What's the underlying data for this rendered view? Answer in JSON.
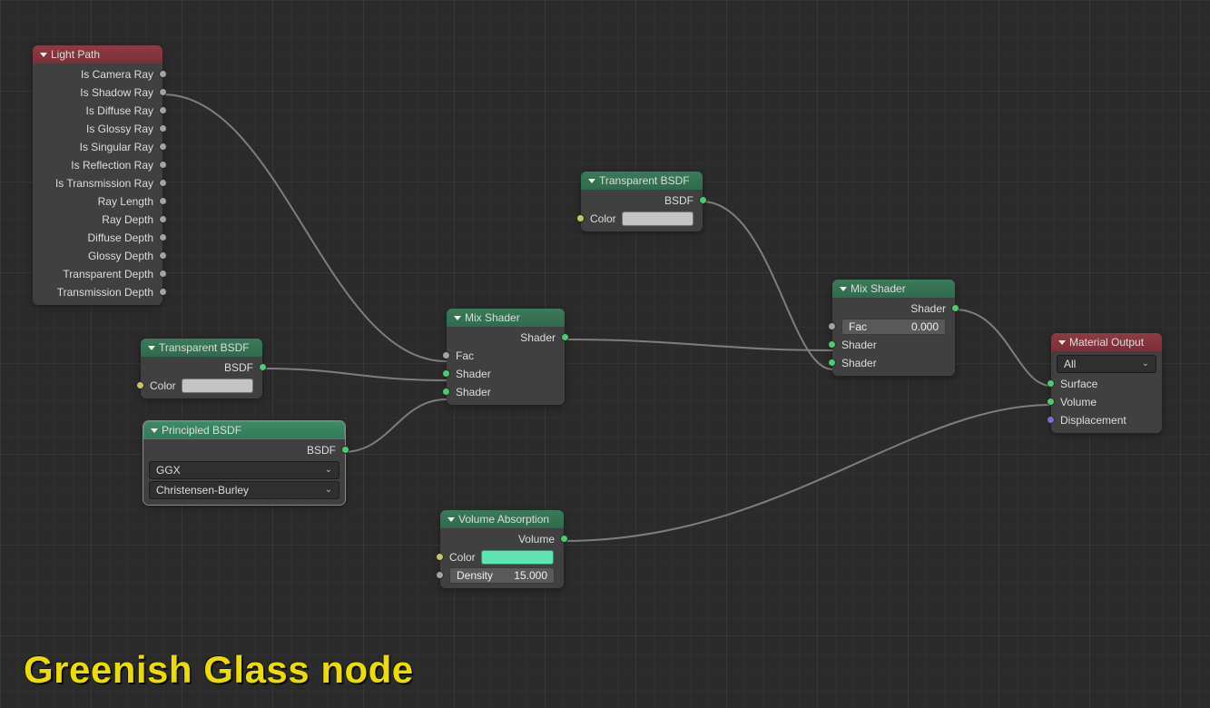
{
  "overlay_title": "Greenish Glass node",
  "nodes": {
    "light_path": {
      "title": "Light Path",
      "outputs": [
        "Is Camera Ray",
        "Is Shadow Ray",
        "Is Diffuse Ray",
        "Is Glossy Ray",
        "Is Singular Ray",
        "Is Reflection Ray",
        "Is Transmission Ray",
        "Ray Length",
        "Ray Depth",
        "Diffuse Depth",
        "Glossy Depth",
        "Transparent Depth",
        "Transmission Depth"
      ]
    },
    "transparent_bsdf_1": {
      "title": "Transparent BSDF",
      "output_label": "BSDF",
      "color_label": "Color",
      "color_swatch": "#c4c4c4"
    },
    "transparent_bsdf_2": {
      "title": "Transparent BSDF",
      "output_label": "BSDF",
      "color_label": "Color",
      "color_swatch": "#c4c4c4"
    },
    "principled_bsdf": {
      "title": "Principled BSDF",
      "output_label": "BSDF",
      "select1": "GGX",
      "select2": "Christensen-Burley"
    },
    "mix_shader_1": {
      "title": "Mix Shader",
      "output_label": "Shader",
      "fac_label": "Fac",
      "shader_in1": "Shader",
      "shader_in2": "Shader"
    },
    "mix_shader_2": {
      "title": "Mix Shader",
      "output_label": "Shader",
      "fac_field_label": "Fac",
      "fac_field_value": "0.000",
      "shader_in1": "Shader",
      "shader_in2": "Shader"
    },
    "volume_absorption": {
      "title": "Volume Absorption",
      "output_label": "Volume",
      "color_label": "Color",
      "color_swatch": "#5de4b0",
      "density_label": "Density",
      "density_value": "15.000"
    },
    "material_output": {
      "title": "Material Output",
      "select": "All",
      "surface": "Surface",
      "volume": "Volume",
      "displacement": "Displacement"
    }
  }
}
